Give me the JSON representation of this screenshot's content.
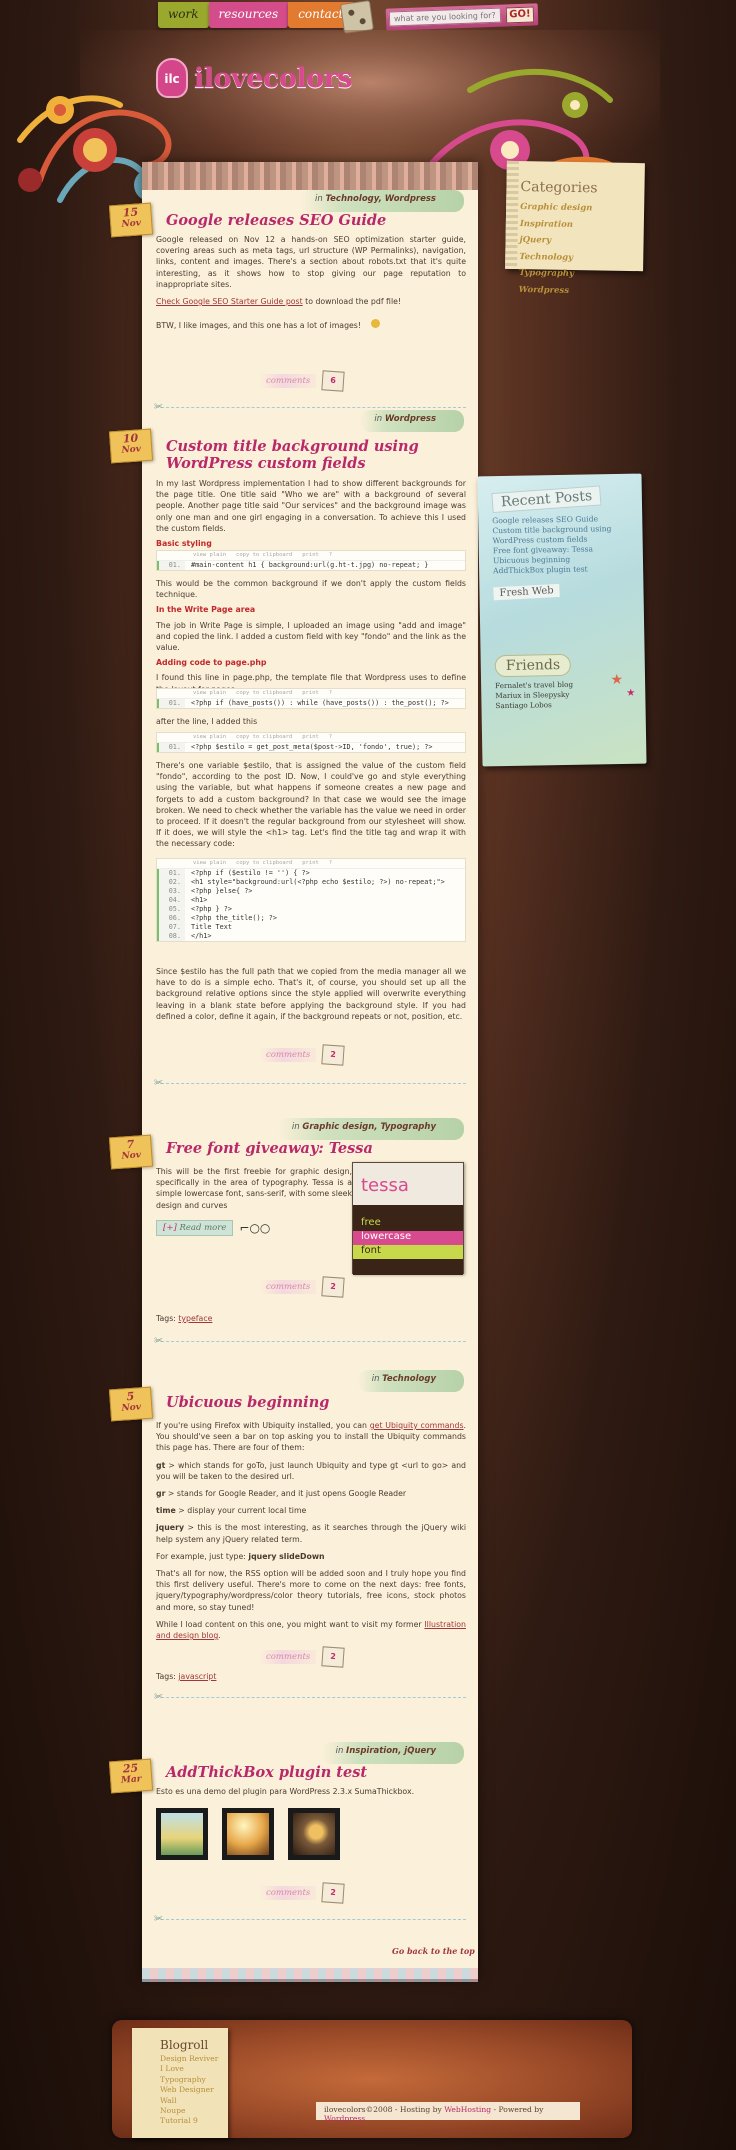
{
  "nav": {
    "work": "work",
    "resources": "resources",
    "contact": "contact"
  },
  "search": {
    "placeholder": "what are you looking for?",
    "go": "GO!"
  },
  "logo": {
    "badge": "ilc",
    "text": "ilovecolors"
  },
  "posts": [
    {
      "day": "15",
      "month": "Nov",
      "categories_prefix": "in",
      "categories": "Technology, Wordpress",
      "title": "Google releases SEO Guide",
      "p1": "Google released on Nov 12 a hands-on SEO optimization starter guide, covering areas such as meta tags, url structure (WP Permalinks), navigation, links, content and images. There's a section about robots.txt that it's quite interesting, as it shows how to stop giving our page reputation to inappropriate sites.",
      "link": "Check Google SEO Starter Guide post",
      "link_suffix": "to download the pdf file!",
      "p2": "BTW, I like images, and this one has a lot of images!",
      "comments": "comments",
      "count": "6"
    },
    {
      "day": "10",
      "month": "Nov",
      "categories_prefix": "in",
      "categories": "Wordpress",
      "title": "Custom title background using WordPress custom fields",
      "p1": "In my last Wordpress implementation I had to show different backgrounds for the page title. One title said \"Who we are\" with a background of several people. Another page title said \"Our services\" and the background image was only one man and one girl engaging in a conversation. To achieve this I used the custom fields.",
      "h_basic": "Basic styling",
      "code1": "#main-content h1 { background:url(g.ht-t.jpg) no-repeat; }",
      "p2": "This would be the common background if we don't apply the custom fields technique.",
      "h_write": "In the Write Page area",
      "p3": "The job in Write Page is simple, I uploaded an image using \"add and image\" and copied the link. I added a custom field with key \"fondo\" and the link as the value.",
      "h_add": "Adding code to page.php",
      "p4": "I found this line in page.php, the template file that Wordpress uses to define the layout for pages:",
      "code2": "<?php if (have_posts()) : while (have_posts()) : the_post(); ?>",
      "p5": "after the line, I added this",
      "code3": "<?php $estilo = get_post_meta($post->ID, 'fondo', true); ?>",
      "p6": "There's one variable $estilo, that is assigned the value of the custom field \"fondo\", according to the post ID. Now, I could've go and style everything using the variable, but what happens if someone creates a new page and forgets to add a custom background? In that case we would see the image broken. We need to check whether the variable has the value we need in order to proceed. If it doesn't the regular background from our stylesheet will show. If it does, we will style the <h1> tag. Let's find the title tag and wrap it with the necessary code:",
      "code4": [
        "<?php if ($estilo != '') { ?>",
        "<h1 style=\"background:url(<?php echo $estilo; ?>) no-repeat;\">",
        "<?php }else{ ?>",
        "<h1>",
        "<?php } ?>",
        "<?php the_title(); ?>",
        "Title Text",
        "</h1>"
      ],
      "p7": "Since $estilo has the full path that we copied from the media manager all we have to do is a simple echo. That's it, of course, you should set up all the background relative options since the style applied will overwrite everything leaving in a blank state before applying the background style. If you had defined a color, define it again, if the background repeats or not, position, etc.",
      "comments": "comments",
      "count": "2"
    },
    {
      "day": "7",
      "month": "Nov",
      "categories_prefix": "in",
      "categories": "Graphic design, Typography",
      "title": "Free font giveaway: Tessa",
      "p1": "This will be the first freebie for graphic design, specifically in the area of typography. Tessa is a simple lowercase font, sans-serif, with some sleek design and curves",
      "readmore": "Read more",
      "tessa": {
        "name": "tessa",
        "l1": "free",
        "l2": "lowercase",
        "l3": "font"
      },
      "comments": "comments",
      "count": "2",
      "tags_label": "Tags:",
      "tags": "typeface"
    },
    {
      "day": "5",
      "month": "Nov",
      "categories_prefix": "in",
      "categories": "Technology",
      "title": "Ubicuous beginning",
      "p1a": "If you're using Firefox with Ubiquity installed, you can",
      "p1link": "get Ubiquity commands",
      "p1b": ". You should've seen a bar on top asking you to install the Ubiquity commands this page has. There are four of them:",
      "gt_k": "gt",
      "gt": "> which stands for goTo, just launch Ubiquity and type gt <url to go> and you will be taken to the desired url.",
      "gr_k": "gr",
      "gr": "> stands for Google Reader, and it just opens Google Reader",
      "time_k": "time",
      "time": "> display your current local time",
      "jq_k": "jquery",
      "jq": "> this is the most interesting, as it searches through the jQuery wiki help system any jQuery related term.",
      "example_pre": "For example, just type:",
      "example": "jquery slideDown",
      "p2": "That's all for now, the RSS option will be added soon and I truly hope you find this first delivery useful. There's more to come on the next days: free fonts, jquery/typography/wordpress/color theory tutorials, free icons, stock photos and more, so stay tuned!",
      "p3": "While I load content on this one, you might want to visit my former",
      "p3link": "Illustration and design blog",
      "comments": "comments",
      "count": "2",
      "tags_label": "Tags:",
      "tags": "javascript"
    },
    {
      "day": "25",
      "month": "Mar",
      "categories_prefix": "in",
      "categories": "Inspiration, jQuery",
      "title": "AddThickBox plugin test",
      "p1": "Esto es una demo del plugin para WordPress 2.3.x SumaThickbox.",
      "comments": "comments",
      "count": "2"
    }
  ],
  "goto_top": "Go back to the top",
  "sidebar": {
    "categories_title": "Categories",
    "categories": [
      "Graphic design",
      "Inspiration",
      "jQuery",
      "Technology",
      "Typography",
      "Wordpress"
    ],
    "recent_title": "Recent Posts",
    "recent": [
      "Google releases SEO Guide",
      "Custom title background using WordPress custom fields",
      "Free font giveaway: Tessa",
      "Ubicuous beginning",
      "AddThickBox plugin test"
    ],
    "freshweb": "Fresh Web",
    "friends_title": "Friends",
    "friends": [
      "Fernalet's travel blog",
      "Mariux in Sleepysky",
      "Santiago Lobos"
    ]
  },
  "footer": {
    "blogroll_title": "Blogroll",
    "blogroll": [
      "Design Reviver",
      "I Love Typography",
      "Web Designer Wall",
      "Noupe",
      "Tutorial 9"
    ],
    "credit_a": "ilovecolors©2008 - Hosting by",
    "credit_host": "WebHosting",
    "credit_b": "- Powered by",
    "credit_wp": "Wordpress"
  },
  "colors": {
    "accent": "#b8286a",
    "gold": "#f0c25a",
    "paper": "#fbf0d9"
  }
}
